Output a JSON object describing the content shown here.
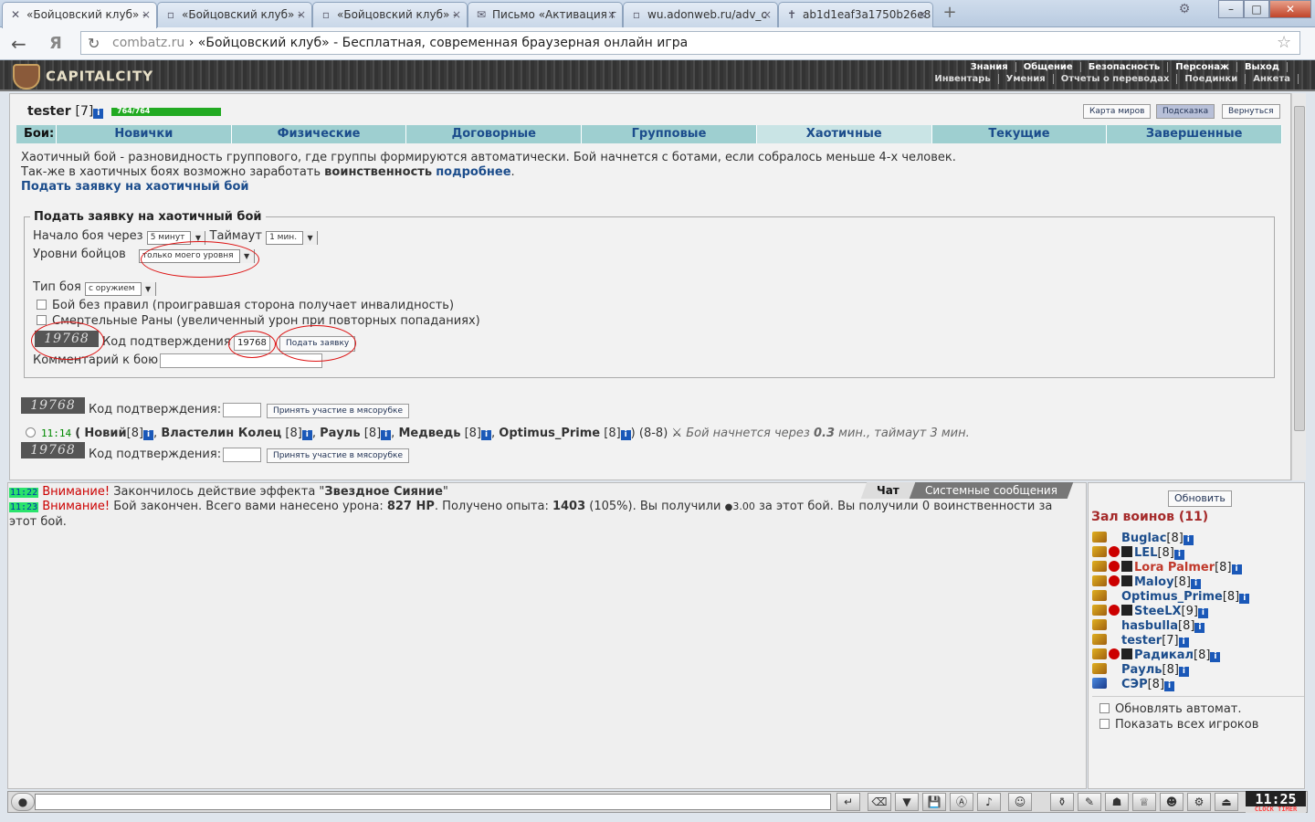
{
  "browser": {
    "tabs": [
      {
        "label": "«Бойцовский клуб» -",
        "icon": "swords-icon"
      },
      {
        "label": "«Бойцовский клуб» -",
        "icon": "page-icon"
      },
      {
        "label": "«Бойцовский клуб» -",
        "icon": "page-icon"
      },
      {
        "label": "Письмо «Активация г",
        "icon": "mail-icon"
      },
      {
        "label": "wu.adonweb.ru/adv_c",
        "icon": "page-icon"
      },
      {
        "label": "ab1d1eaf3a1750b26e8",
        "icon": "cross-icon"
      }
    ],
    "address_host": "combatz.ru",
    "address_title": "«Бойцовский клуб» - Бесплатная, современная браузерная онлайн игра"
  },
  "site": {
    "logo": "CAPITALCITY",
    "menu_top": [
      "Знания",
      "Общение",
      "Безопасность",
      "Персонаж",
      "Выход"
    ],
    "menu_bottom": [
      "Инвентарь",
      "Умения",
      "Отчеты о переводах",
      "Поединки",
      "Анкета"
    ]
  },
  "player": {
    "name": "tester",
    "level": "[7]",
    "hp": "764/764",
    "hp_fraction": 1.0
  },
  "top_buttons": [
    "Карта миров",
    "Подсказка",
    "Вернуться"
  ],
  "fight_tabs": {
    "label": "Бои:",
    "items": [
      "Новички",
      "Физические",
      "Договорные",
      "Групповые",
      "Хаотичные",
      "Текущие",
      "Завершенные"
    ],
    "active": "Хаотичные"
  },
  "intro": {
    "line1": "Хаотичный бой - разновидность группового, где группы формируются автоматически. Бой начнется с ботами, если собралось меньше 4-х человек.",
    "line2_a": "Так-же в хаотичных боях возможно заработать ",
    "line2_b": "воинственность",
    "line2_c": "подробнее",
    "line2_d": ".",
    "apply_link": "Подать заявку на хаотичный бой"
  },
  "form": {
    "legend": "Подать заявку на хаотичный бой",
    "start_label": "Начало боя через",
    "start_value": "5 минут",
    "timeout_label": "Таймаут",
    "timeout_value": "1 мин.",
    "levels_label": "Уровни бойцов",
    "levels_value": "только моего уровня",
    "type_label": "Тип боя",
    "type_value": "с оружием",
    "no_rules": "Бой без правил (проигравшая сторона получает инвалидность)",
    "mortal": "Смертельные Раны (увеличенный урон при повторных попаданиях)",
    "captcha": "19768",
    "code_label": "Код подтверждения",
    "code_value": "19768",
    "submit": "Подать заявку",
    "comment_label": "Комментарий к бою"
  },
  "meat1": {
    "captcha": "19768",
    "code_label": "Код подтверждения:",
    "button": "Принять участие в мясорубке"
  },
  "battle": {
    "time": "11:14",
    "open": "(",
    "participants": [
      {
        "name": "Новий",
        "lv": "[8]"
      },
      {
        "name": "Властелин Колец",
        "lv": "[8]"
      },
      {
        "name": "Рауль",
        "lv": "[8]"
      },
      {
        "name": "Медведь",
        "lv": "[8]"
      },
      {
        "name": "Optimus_Prime",
        "lv": "[8]"
      }
    ],
    "close": ")",
    "range": "(8-8)",
    "status_a": "Бой начнется через ",
    "status_b": "0.3",
    "status_c": " мин., таймаут 3 мин."
  },
  "meat2": {
    "captcha": "19768",
    "code_label": "Код подтверждения:",
    "button": "Принять участие в мясорубке"
  },
  "chat": {
    "tabs": [
      "Чат",
      "Системные сообщения"
    ],
    "msg1": {
      "time": "11:22",
      "warn": "Внимание!",
      "a": " Закончилось действие эффекта \"",
      "b": "Звездное Сияние",
      "c": "\""
    },
    "msg2": {
      "time": "11:23",
      "warn": "Внимание!",
      "a": " Бой закончен. Всего вами нанесено урона: ",
      "b": "827 HP",
      "c": ". Получено опыта: ",
      "d": "1403",
      "e": " (105%). Вы получили ",
      "f": "3.00",
      "g": " за этот бой. Вы получили 0 воинственности за этот бой."
    }
  },
  "hall": {
    "refresh": "Обновить",
    "title": "Зал воинов (11)",
    "players": [
      {
        "name": "Buglac",
        "lv": "[8]"
      },
      {
        "name": "LEL",
        "lv": "[8]"
      },
      {
        "name": "Lora Palmer",
        "lv": "[8]"
      },
      {
        "name": "Maloy",
        "lv": "[8]"
      },
      {
        "name": "Optimus_Prime",
        "lv": "[8]"
      },
      {
        "name": "SteeLX",
        "lv": "[9]"
      },
      {
        "name": "hasbulla",
        "lv": "[8]"
      },
      {
        "name": "tester",
        "lv": "[7]"
      },
      {
        "name": "Радикал",
        "lv": "[8]"
      },
      {
        "name": "Рауль",
        "lv": "[8]"
      },
      {
        "name": "СЭР",
        "lv": "[8]"
      }
    ],
    "auto_refresh": "Обновлять автомат.",
    "show_all": "Показать всех игроков"
  },
  "clock": {
    "time": "11:25",
    "label": "CLOCK TIMER"
  },
  "colors": {
    "accent": "#1c4d8c",
    "tab_bg": "#9ecfd0",
    "hp_bar": "#22aa22",
    "warn": "#cc0000"
  }
}
